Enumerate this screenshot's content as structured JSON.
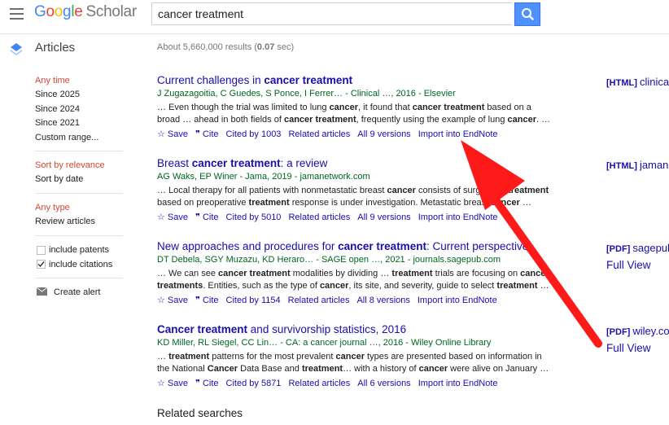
{
  "header": {
    "logo_google": "Google",
    "logo_scholar": "Scholar",
    "search_value": "cancer treatment"
  },
  "articles_label": "Articles",
  "results_count": "About 5,660,000 results (0.07 sec)",
  "sidebar": {
    "time": [
      "Any time",
      "Since 2025",
      "Since 2024",
      "Since 2021",
      "Custom range..."
    ],
    "sort": [
      "Sort by relevance",
      "Sort by date"
    ],
    "type": [
      "Any type",
      "Review articles"
    ],
    "include_patents": "include patents",
    "include_citations": "include citations",
    "create_alert": "Create alert"
  },
  "results": [
    {
      "title_pre": "Current challenges in ",
      "title_bold": "cancer treatment",
      "title_post": "",
      "authors": "J Zugazagoitia, C Guedes, S Ponce, I Ferrer… - Clinical …, 2016 - Elsevier",
      "snippet1": "… Even though the trial was limited to lung cancer, it found that cancer treatment based on a",
      "snippet2": "broad … ahead in both fields of cancer treatment, frequently using the example of lung cancer. …",
      "save": "Save",
      "cite": "Cite",
      "cited": "Cited by 1003",
      "related": "Related articles",
      "versions": "All 9 versions",
      "endnote": "Import into EndNote",
      "tag_kind": "[HTML]",
      "tag_src": "clinica",
      "fullview": ""
    },
    {
      "title_pre": "Breast ",
      "title_bold": "cancer treatment",
      "title_post": ": a review",
      "authors": "AG Waks, EP Winer - Jama, 2019 - jamanetwork.com",
      "snippet1": "… Local therapy for all patients with nonmetastatic breast cancer consists of surgical … treatment",
      "snippet2": "based on preoperative treatment response is under investigation. Metastatic breast cancer …",
      "save": "Save",
      "cite": "Cite",
      "cited": "Cited by 5010",
      "related": "Related articles",
      "versions": "All 9 versions",
      "endnote": "Import into EndNote",
      "tag_kind": "[HTML]",
      "tag_src": "jamane",
      "fullview": ""
    },
    {
      "title_pre": "New approaches and procedures for ",
      "title_bold": "cancer treatment",
      "title_post": ": Current perspective",
      "authors": "DT Debela, SGY Muzazu, KD Heraro… - SAGE open …, 2021 - journals.sagepub.com",
      "snippet1": "… We can see cancer treatment modalities by dividing … treatment trials are focusing on cancer",
      "snippet2": "treatments. Entities, such as the type of cancer, its site, and severity, guide to select treatment …",
      "save": "Save",
      "cite": "Cite",
      "cited": "Cited by 1154",
      "related": "Related articles",
      "versions": "All 8 versions",
      "endnote": "Import into EndNote",
      "tag_kind": "[PDF]",
      "tag_src": "sagepub",
      "fullview": "Full View"
    },
    {
      "title_pre": "",
      "title_bold": "Cancer treatment",
      "title_post": " and survivorship statistics, 2016",
      "authors": "KD Miller, RL Siegel, CC Lin… - CA: a cancer journal …, 2016 - Wiley Online Library",
      "snippet1": "… treatment patterns for the most prevalent cancer types are presented based on information in",
      "snippet2": "the National Cancer Data Base and treatment… with a history of cancer were alive on January …",
      "save": "Save",
      "cite": "Cite",
      "cited": "Cited by 5871",
      "related": "Related articles",
      "versions": "All 6 versions",
      "endnote": "Import into EndNote",
      "tag_kind": "[PDF]",
      "tag_src": "wiley.co",
      "fullview": "Full View"
    }
  ],
  "related_searches": "Related searches",
  "colors": {
    "link": "#1a0dab",
    "green": "#006621",
    "red_accent": "#d14836",
    "arrow": "#ff1a1a",
    "search_button": "#4d90fe"
  },
  "icons": [
    "menu-icon",
    "search-icon",
    "articles-icon",
    "star-icon",
    "quote-icon",
    "mail-icon",
    "check-icon",
    "red-arrow"
  ]
}
